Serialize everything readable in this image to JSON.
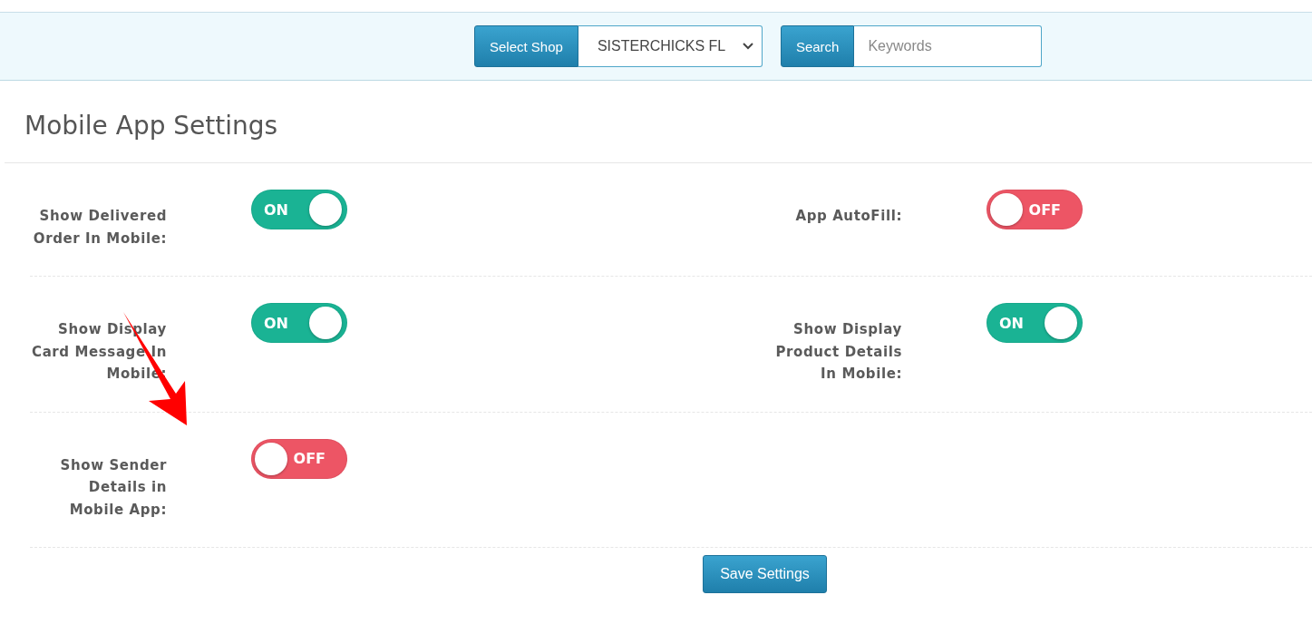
{
  "toolbar": {
    "shop_button": "Select Shop",
    "shop_value": "SISTERCHICKS FL",
    "search_button": "Search",
    "search_placeholder": "Keywords"
  },
  "title": "Mobile App Settings",
  "rows": [
    {
      "settings": [
        {
          "label": "Show Delivered Order In Mobile:",
          "on": true,
          "state_text": "ON"
        },
        {
          "label": "App AutoFill:",
          "on": false,
          "state_text": "OFF"
        }
      ]
    },
    {
      "settings": [
        {
          "label": "Show Display Card Message In Mobile:",
          "on": true,
          "state_text": "ON"
        },
        {
          "label": "Show Display Product Details In Mobile:",
          "on": true,
          "state_text": "ON"
        }
      ]
    },
    {
      "settings": [
        {
          "label": "Show Sender Details in Mobile App:",
          "on": false,
          "state_text": "OFF"
        }
      ]
    }
  ],
  "save_button": "Save Settings"
}
